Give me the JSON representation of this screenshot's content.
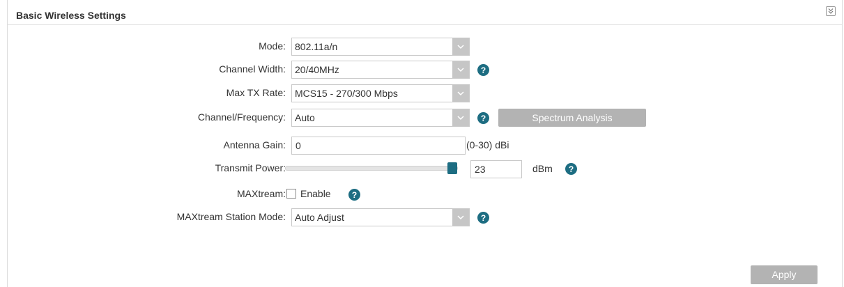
{
  "panel": {
    "title": "Basic Wireless Settings"
  },
  "fields": {
    "mode": {
      "label": "Mode:",
      "value": "802.11a/n"
    },
    "channel_width": {
      "label": "Channel Width:",
      "value": "20/40MHz"
    },
    "max_tx_rate": {
      "label": "Max TX Rate:",
      "value": "MCS15 - 270/300 Mbps"
    },
    "channel_frequency": {
      "label": "Channel/Frequency:",
      "value": "Auto",
      "button_label": "Spectrum Analysis"
    },
    "antenna_gain": {
      "label": "Antenna Gain:",
      "value": "0",
      "unit": "(0-30) dBi"
    },
    "transmit_power": {
      "label": "Transmit Power:",
      "value": "23",
      "unit": "dBm",
      "slider_level": 1.0
    },
    "maxtream": {
      "label": "MAXtream:",
      "checkbox_label": "Enable",
      "checked": false
    },
    "maxtream_station_mode": {
      "label": "MAXtream Station Mode:",
      "value": "Auto Adjust"
    }
  },
  "help_glyph": "?",
  "apply_label": "Apply",
  "icons": {
    "collapse": "double-chevron-down-icon",
    "dropdown": "chevron-down-icon",
    "help": "question-mark-icon"
  },
  "colors": {
    "help_icon": "#1d6d82",
    "button": "#b3b3b3",
    "slider_handle": "#1d6d82"
  }
}
